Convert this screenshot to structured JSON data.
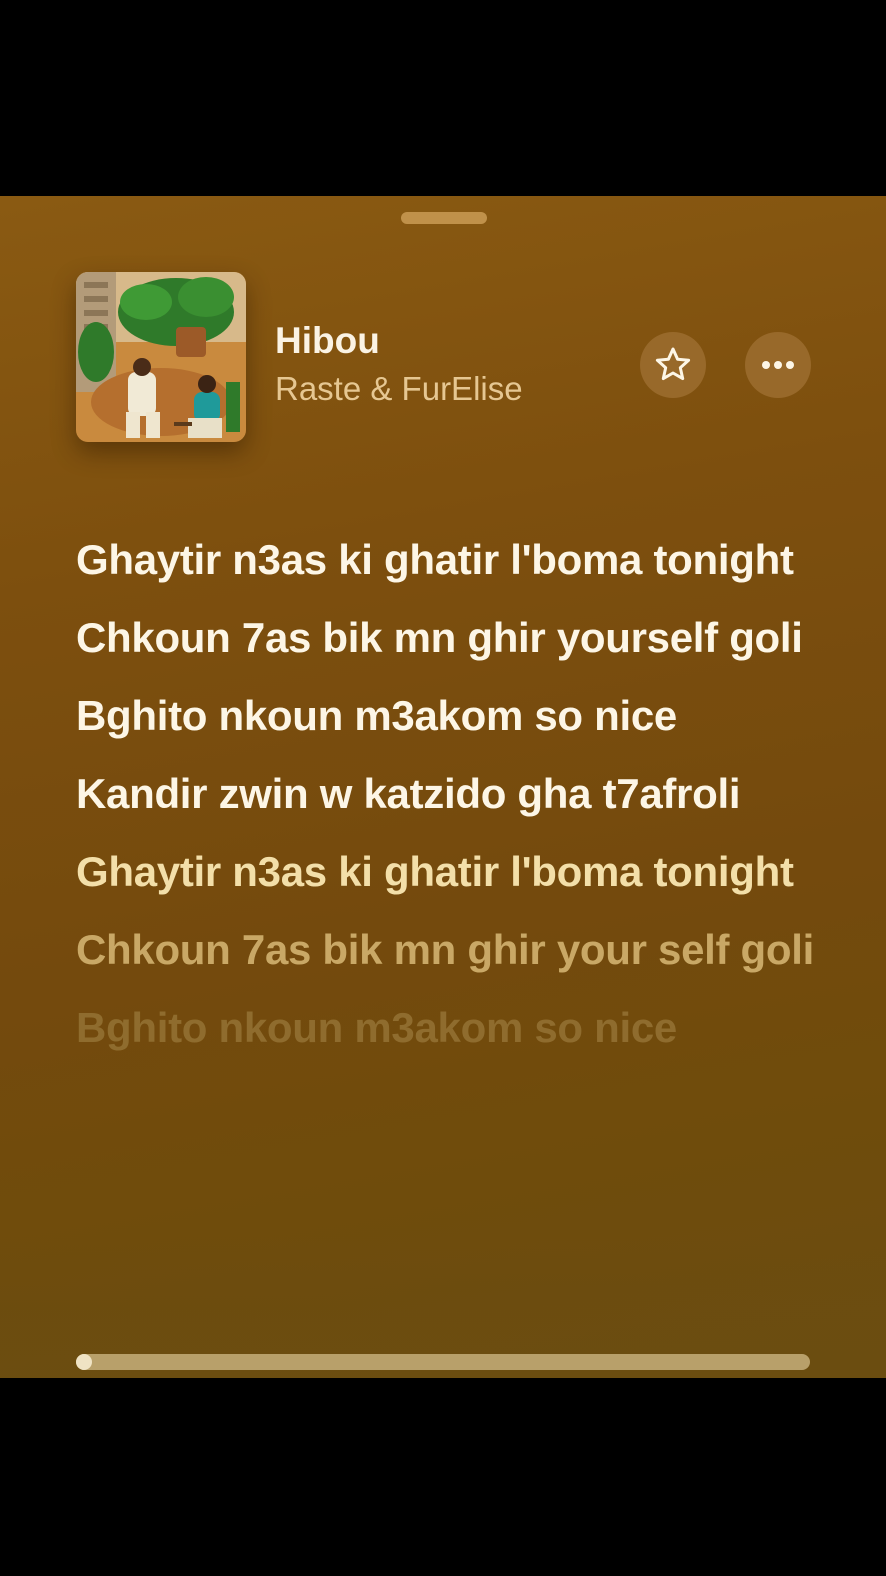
{
  "now_playing": {
    "title": "Hibou",
    "artist": "Raste & FurElise",
    "artwork_icon": "album-artwork-image",
    "favorite_icon": "star-icon",
    "more_icon": "ellipsis-icon"
  },
  "lyrics": [
    {
      "text": "Ghaytir n3as ki ghatir l'boma tonight",
      "state": "sung"
    },
    {
      "text": "Chkoun 7as bik mn ghir yourself goli",
      "state": "sung"
    },
    {
      "text": "Bghito nkoun m3akom so nice",
      "state": "sung"
    },
    {
      "text": "Kandir zwin w katzido gha t7afroli",
      "state": "sung"
    },
    {
      "text": "Ghaytir n3as ki ghatir l'boma tonight",
      "state": "upcoming"
    },
    {
      "text": "Chkoun 7as bik mn ghir your self goli",
      "state": "faded"
    },
    {
      "text": "Bghito nkoun m3akom so nice",
      "state": "clip"
    }
  ],
  "playback": {
    "progress": 0.01
  },
  "colors": {
    "background": "#7a4e0e",
    "lyric_active": "#fdf6e6",
    "artist": "#e6c792",
    "button": "#98692a"
  }
}
